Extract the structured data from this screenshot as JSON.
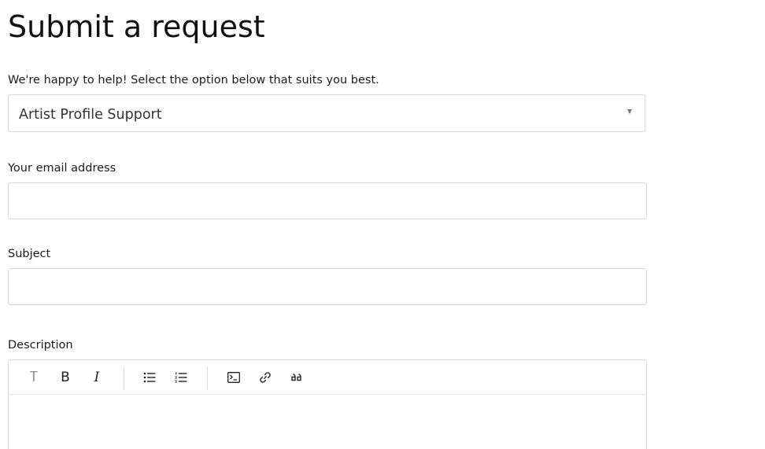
{
  "page": {
    "title": "Submit a request",
    "intro": "We're happy to help! Select the option below that suits you best."
  },
  "request_type": {
    "selected": "Artist Profile Support"
  },
  "form": {
    "email_label": "Your email address",
    "email_value": "",
    "subject_label": "Subject",
    "subject_value": "",
    "description_label": "Description"
  },
  "toolbar": {
    "text_style_glyph": "T",
    "bold_glyph": "B",
    "italic_glyph": "I",
    "icons": [
      "text-style-icon",
      "bold-icon",
      "italic-icon",
      "bulleted-list-icon",
      "numbered-list-icon",
      "code-block-icon",
      "link-icon",
      "quote-icon"
    ]
  }
}
